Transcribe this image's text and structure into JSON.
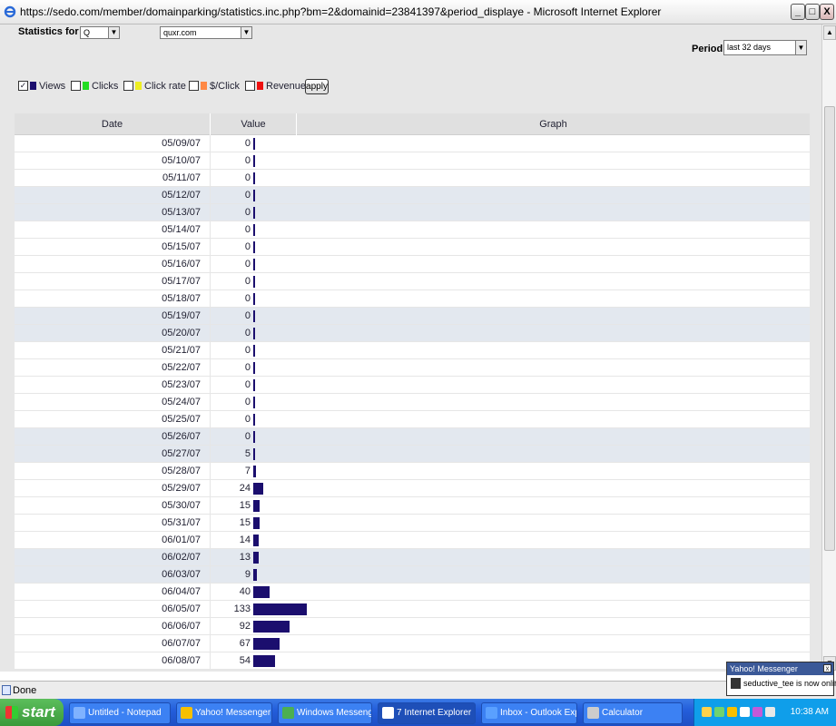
{
  "window": {
    "title": "https://sedo.com/member/domainparking/statistics.inc.php?bm=2&domainid=23841397&period_displaye - Microsoft Internet Explorer",
    "minimize": "_",
    "maximize": "□",
    "close": "X"
  },
  "filters": {
    "statistics_for_label": "Statistics for",
    "type_value": "Q",
    "domain_value": "quxr.com",
    "period_label": "Period",
    "period_value": "last 32 days"
  },
  "legend": [
    {
      "label": "Views",
      "checked": true,
      "color": "#1b0e6e"
    },
    {
      "label": "Clicks",
      "checked": false,
      "color": "#22dd22"
    },
    {
      "label": "Click rate",
      "checked": false,
      "color": "#eeee22"
    },
    {
      "label": "$/Click",
      "checked": false,
      "color": "#ff8844"
    },
    {
      "label": "Revenue",
      "checked": false,
      "color": "#ee1111"
    }
  ],
  "apply_label": "apply",
  "table": {
    "headers": {
      "date": "Date",
      "value": "Value",
      "graph": "Graph"
    },
    "rows": [
      {
        "date": "05/09/07",
        "value": "0",
        "weekend": false
      },
      {
        "date": "05/10/07",
        "value": "0",
        "weekend": false
      },
      {
        "date": "05/11/07",
        "value": "0",
        "weekend": false
      },
      {
        "date": "05/12/07",
        "value": "0",
        "weekend": true
      },
      {
        "date": "05/13/07",
        "value": "0",
        "weekend": true
      },
      {
        "date": "05/14/07",
        "value": "0",
        "weekend": false
      },
      {
        "date": "05/15/07",
        "value": "0",
        "weekend": false
      },
      {
        "date": "05/16/07",
        "value": "0",
        "weekend": false
      },
      {
        "date": "05/17/07",
        "value": "0",
        "weekend": false
      },
      {
        "date": "05/18/07",
        "value": "0",
        "weekend": false
      },
      {
        "date": "05/19/07",
        "value": "0",
        "weekend": true
      },
      {
        "date": "05/20/07",
        "value": "0",
        "weekend": true
      },
      {
        "date": "05/21/07",
        "value": "0",
        "weekend": false
      },
      {
        "date": "05/22/07",
        "value": "0",
        "weekend": false
      },
      {
        "date": "05/23/07",
        "value": "0",
        "weekend": false
      },
      {
        "date": "05/24/07",
        "value": "0",
        "weekend": false
      },
      {
        "date": "05/25/07",
        "value": "0",
        "weekend": false
      },
      {
        "date": "05/26/07",
        "value": "0",
        "weekend": true
      },
      {
        "date": "05/27/07",
        "value": "5",
        "weekend": true
      },
      {
        "date": "05/28/07",
        "value": "7",
        "weekend": false
      },
      {
        "date": "05/29/07",
        "value": "24",
        "weekend": false
      },
      {
        "date": "05/30/07",
        "value": "15",
        "weekend": false
      },
      {
        "date": "05/31/07",
        "value": "15",
        "weekend": false
      },
      {
        "date": "06/01/07",
        "value": "14",
        "weekend": false
      },
      {
        "date": "06/02/07",
        "value": "13",
        "weekend": true
      },
      {
        "date": "06/03/07",
        "value": "9",
        "weekend": true
      },
      {
        "date": "06/04/07",
        "value": "40",
        "weekend": false
      },
      {
        "date": "06/05/07",
        "value": "133",
        "weekend": false
      },
      {
        "date": "06/06/07",
        "value": "92",
        "weekend": false
      },
      {
        "date": "06/07/07",
        "value": "67",
        "weekend": false
      },
      {
        "date": "06/08/07",
        "value": "54",
        "weekend": false
      }
    ]
  },
  "status": {
    "text": "Done"
  },
  "notification": {
    "title": "Yahoo! Messenger",
    "message": "seductive_tee is now online"
  },
  "taskbar": {
    "start": "start",
    "tasks": [
      {
        "label": "Untitled - Notepad",
        "active": false,
        "color": "#7fb2ff"
      },
      {
        "label": "Yahoo! Messenger",
        "active": false,
        "color": "#f7c000"
      },
      {
        "label": "Windows Messenger",
        "active": false,
        "color": "#4caf50"
      },
      {
        "label": "7 Internet Explorer",
        "active": true,
        "color": "#ffffff"
      },
      {
        "label": "Inbox - Outlook Expr...",
        "active": false,
        "color": "#5aa0ff"
      },
      {
        "label": "Calculator",
        "active": false,
        "color": "#cccccc"
      }
    ],
    "clock": "10:38 AM"
  }
}
